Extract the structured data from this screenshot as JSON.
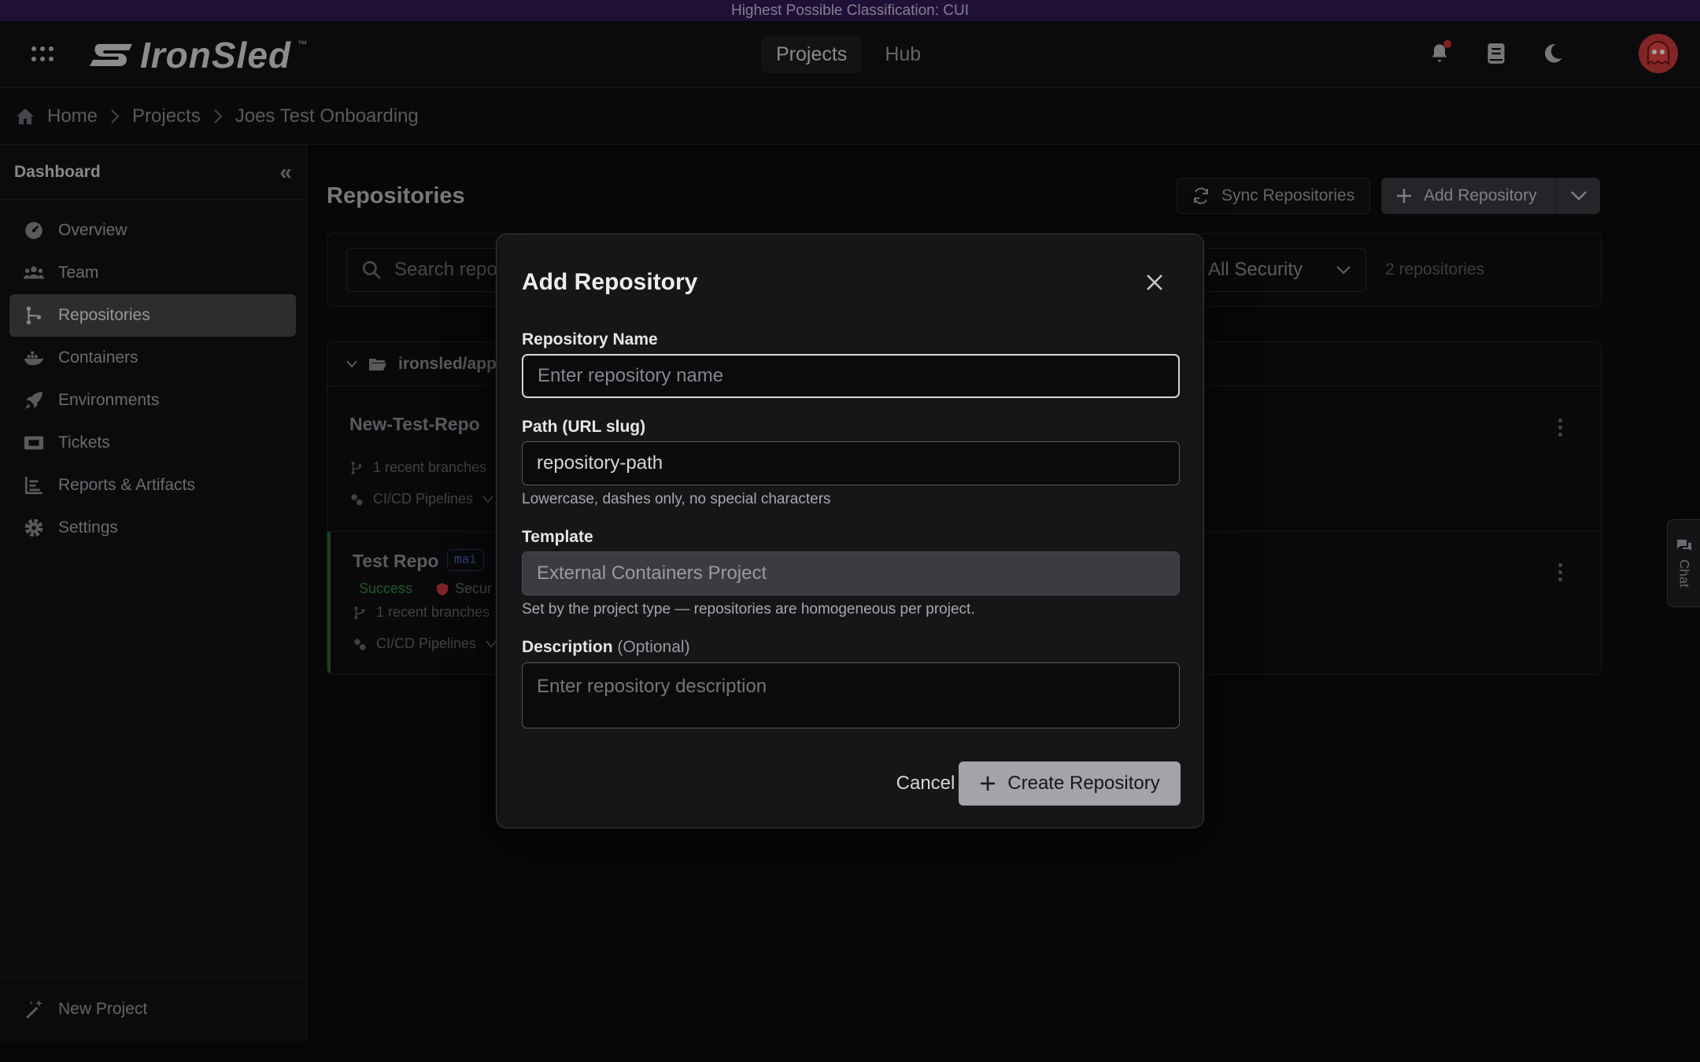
{
  "classification": "Highest Possible Classification: CUI",
  "brand": {
    "name": "IronSled",
    "tm": "™"
  },
  "nav": {
    "tabs": [
      {
        "label": "Projects"
      },
      {
        "label": "Hub"
      }
    ]
  },
  "breadcrumb": [
    "Home",
    "Projects",
    "Joes Test Onboarding"
  ],
  "sidebar": {
    "title": "Dashboard",
    "items": [
      {
        "label": "Overview"
      },
      {
        "label": "Team"
      },
      {
        "label": "Repositories"
      },
      {
        "label": "Containers"
      },
      {
        "label": "Environments"
      },
      {
        "label": "Tickets"
      },
      {
        "label": "Reports & Artifacts"
      },
      {
        "label": "Settings"
      }
    ],
    "footer": "New Project"
  },
  "main": {
    "title": "Repositories",
    "sync_label": "Sync Repositories",
    "add_label": "Add Repository",
    "search_placeholder": "Search repo",
    "security_filter": "All Security",
    "repo_count": "2 repositories",
    "group": "ironsled/app",
    "repos": [
      {
        "name": "New-Test-Repo",
        "branches": "1 recent branches",
        "pipelines": "CI/CD Pipelines"
      },
      {
        "name": "Test Repo",
        "branch": "mai",
        "status": "Success",
        "security": "Secur",
        "branches": "1 recent branches",
        "pipelines": "CI/CD Pipelines"
      }
    ]
  },
  "chat": "Chat",
  "modal": {
    "title": "Add Repository",
    "name_label": "Repository Name",
    "name_placeholder": "Enter repository name",
    "path_label": "Path (URL slug)",
    "path_value": "repository-path",
    "path_hint": "Lowercase, dashes only, no special characters",
    "template_label": "Template",
    "template_value": "External Containers Project",
    "template_hint": "Set by the project type — repositories are homogeneous per project.",
    "desc_label": "Description",
    "desc_optional": "(Optional)",
    "desc_placeholder": "Enter repository description",
    "cancel": "Cancel",
    "create": "Create Repository"
  }
}
